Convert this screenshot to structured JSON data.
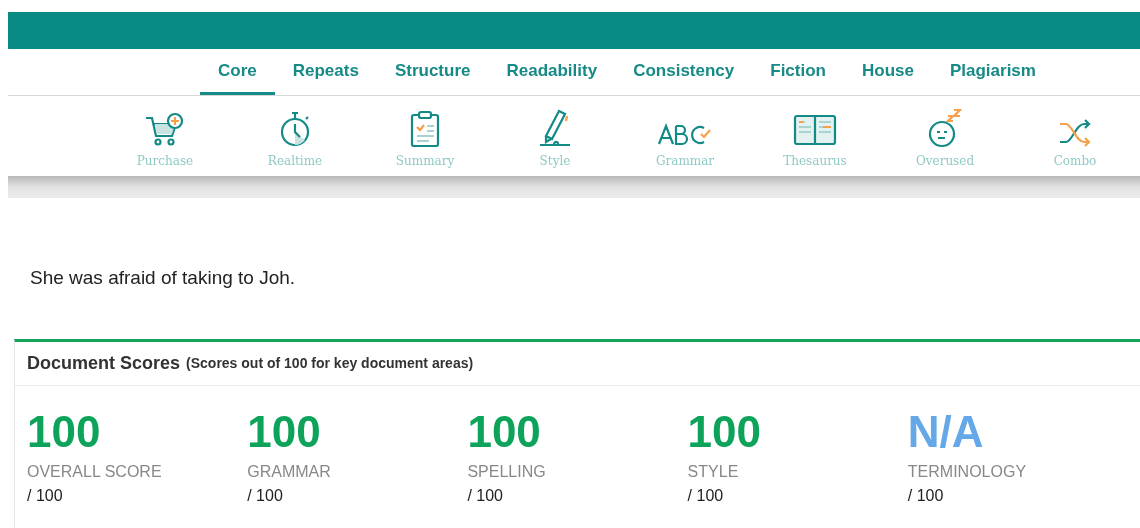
{
  "tabs": [
    {
      "label": "Core",
      "selected": true
    },
    {
      "label": "Repeats",
      "selected": false
    },
    {
      "label": "Structure",
      "selected": false
    },
    {
      "label": "Readability",
      "selected": false
    },
    {
      "label": "Consistency",
      "selected": false
    },
    {
      "label": "Fiction",
      "selected": false
    },
    {
      "label": "House",
      "selected": false
    },
    {
      "label": "Plagiarism",
      "selected": false
    }
  ],
  "tools": [
    {
      "label": "Purchase"
    },
    {
      "label": "Realtime"
    },
    {
      "label": "Summary"
    },
    {
      "label": "Style"
    },
    {
      "label": "Grammar"
    },
    {
      "label": "Thesaurus"
    },
    {
      "label": "Overused"
    },
    {
      "label": "Combo"
    }
  ],
  "document_text": "She was afraid of taking to Joh.",
  "scores_panel": {
    "title": "Document Scores",
    "subtitle": "(Scores out of 100 for key document areas)",
    "scores": [
      {
        "value": "100",
        "label": "OVERALL SCORE",
        "out_of": "/ 100",
        "color": "#0ea35a"
      },
      {
        "value": "100",
        "label": "GRAMMAR",
        "out_of": "/ 100",
        "color": "#0ea35a"
      },
      {
        "value": "100",
        "label": "SPELLING",
        "out_of": "/ 100",
        "color": "#0ea35a"
      },
      {
        "value": "100",
        "label": "STYLE",
        "out_of": "/ 100",
        "color": "#0ea35a"
      },
      {
        "value": "N/A",
        "label": "TERMINOLOGY",
        "out_of": "/ 100",
        "color": "#64a8e8"
      }
    ]
  }
}
